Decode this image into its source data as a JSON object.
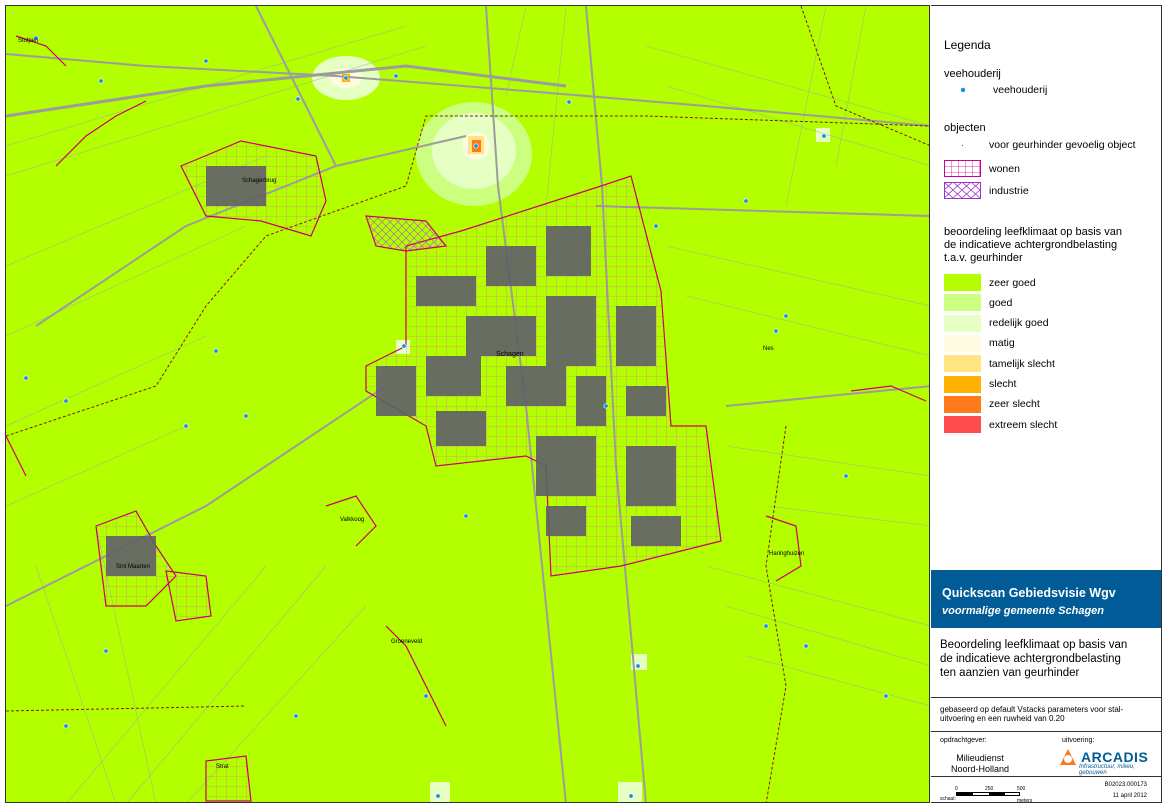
{
  "map": {
    "background_color": "#b3ff00",
    "road_color": "#9c9c9c",
    "water_color": "#8fa6b8",
    "boundary_color": "#cc0066",
    "place_names": [
      "Stolpen",
      "Schagerbrug",
      "Schagen",
      "Nes",
      "Valkkoog",
      "Sint Maarten",
      "Haringhuizen",
      "Groeneveld",
      "Strat"
    ]
  },
  "legend": {
    "title": "Legenda",
    "veehouderij": {
      "header": "veehouderij",
      "item": "veehouderij",
      "icon": "farm-point-icon",
      "color": "#1a8fd6"
    },
    "objecten": {
      "header": "objecten",
      "items": [
        {
          "label": "voor geurhinder gevoelig object",
          "icon": "dot-icon"
        },
        {
          "label": "wonen",
          "icon": "grid-hatch-icon",
          "color": "#cc0099"
        },
        {
          "label": "industrie",
          "icon": "cross-hatch-icon",
          "color": "#9933cc"
        }
      ]
    },
    "beoordeling": {
      "header_line1": "beoordeling leefklimaat op basis van",
      "header_line2": "de indicatieve achtergrondbelasting",
      "header_line3": "t.a.v. geurhinder",
      "classes": [
        {
          "label": "zeer goed",
          "color": "#b3ff00"
        },
        {
          "label": "goed",
          "color": "#ccff80"
        },
        {
          "label": "redelijk goed",
          "color": "#e6ffc2"
        },
        {
          "label": "matig",
          "color": "#fffae0"
        },
        {
          "label": "tamelijk slecht",
          "color": "#ffe680"
        },
        {
          "label": "slecht",
          "color": "#ffb300"
        },
        {
          "label": "zeer slecht",
          "color": "#ff7a1a"
        },
        {
          "label": "extreem slecht",
          "color": "#ff4d4d"
        }
      ]
    }
  },
  "title_block": {
    "main": "Quickscan Gebiedsvisie Wgv",
    "sub": "voormalige gemeente Schagen",
    "background": "#005b96"
  },
  "description": {
    "line1": "Beoordeling leefklimaat op basis van",
    "line2": "de indicatieve achtergrondbelasting",
    "line3": "ten aanzien van geurhinder"
  },
  "note": {
    "line1": "gebaseerd op default Vstacks parameters voor stal-",
    "line2": "uitvoering en een ruwheid van 0.20"
  },
  "credits": {
    "client_label": "opdrachtgever:",
    "client_line1": "Milieudienst",
    "client_line2": "Noord-Holland",
    "exec_label": "uitvoering:",
    "company": "ARCADIS",
    "company_tagline": "Infrastructuur, milieu, gebouwen"
  },
  "footer": {
    "doc_number": "B02023.000173",
    "date": "11 april 2012",
    "scale_label": "schaal:",
    "scale_ticks": [
      "0",
      "250",
      "500"
    ],
    "scale_unit": "meters"
  }
}
